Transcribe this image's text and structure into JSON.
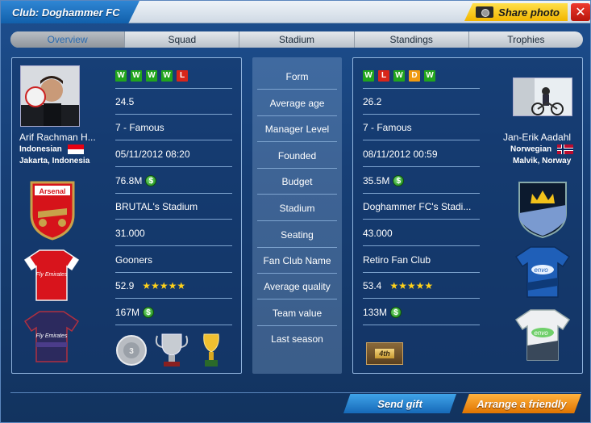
{
  "window": {
    "title": "Club: Doghammer FC",
    "share_label": "Share photo",
    "close_label": "✕"
  },
  "tabs": [
    {
      "label": "Overview",
      "active": true
    },
    {
      "label": "Squad",
      "active": false
    },
    {
      "label": "Stadium",
      "active": false
    },
    {
      "label": "Standings",
      "active": false
    },
    {
      "label": "Trophies",
      "active": false
    }
  ],
  "fields": [
    "Form",
    "Average age",
    "Manager Level",
    "Founded",
    "Budget",
    "Stadium",
    "Seating",
    "Fan Club Name",
    "Average quality",
    "Team value",
    "Last season"
  ],
  "left": {
    "manager_name": "Arif Rachman H...",
    "nationality": "Indonesian",
    "location": "Jakarta, Indonesia",
    "form": [
      "W",
      "W",
      "W",
      "W",
      "L"
    ],
    "average_age": "24.5",
    "manager_level": "7 - Famous",
    "founded": "05/11/2012 08:20",
    "budget": "76.8M",
    "stadium": "BRUTAL's Stadium",
    "seating": "31.000",
    "fan_club": "Gooners",
    "average_quality": "52.9",
    "team_value": "167M",
    "club_crest_text": "Arsenal",
    "kit_text": "Fly Emirates"
  },
  "right": {
    "manager_name": "Jan-Erik Aadahl",
    "nationality": "Norwegian",
    "location": "Malvik, Norway",
    "form": [
      "W",
      "L",
      "W",
      "D",
      "W"
    ],
    "average_age": "26.2",
    "manager_level": "7 - Famous",
    "founded": "08/11/2012 00:59",
    "budget": "35.5M",
    "stadium": "Doghammer FC's Stadi...",
    "seating": "43.000",
    "fan_club": "Retiro Fan Club",
    "average_quality": "53.4",
    "team_value": "133M",
    "last_season": "4th",
    "kit_text": "envo"
  },
  "footer": {
    "send_gift": "Send gift",
    "arrange_friendly": "Arrange a friendly"
  },
  "colors": {
    "win": "#22a51d",
    "loss": "#d8261a",
    "draw": "#f09a10",
    "star": "#ffd21a",
    "accent_blue": "#1f74c4",
    "accent_orange": "#f08a10"
  }
}
